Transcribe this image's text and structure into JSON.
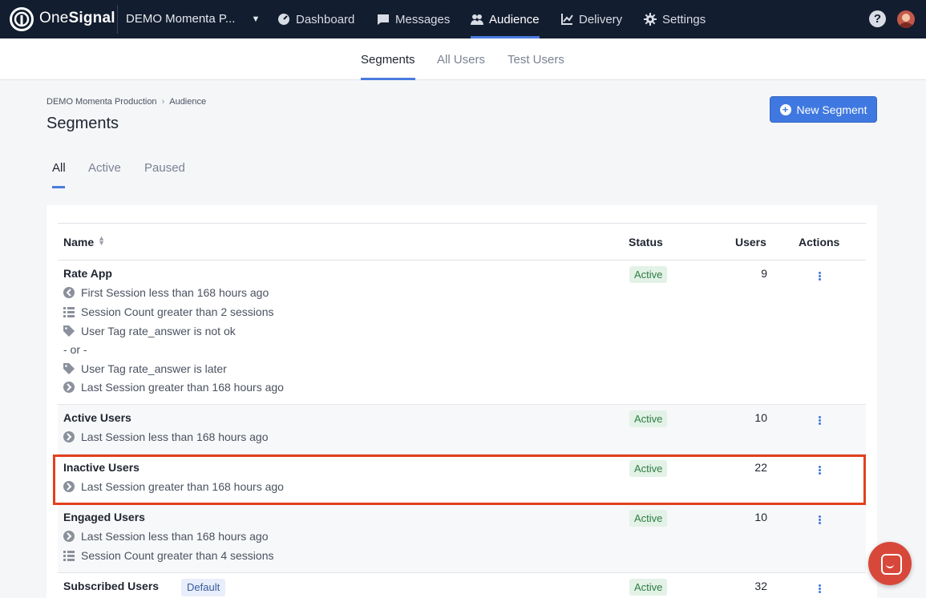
{
  "brand": {
    "name_light": "One",
    "name_bold": "Signal"
  },
  "app_selector": {
    "value": "DEMO Momenta P..."
  },
  "nav": {
    "items": [
      {
        "label": "Dashboard",
        "icon": "dashboard-icon"
      },
      {
        "label": "Messages",
        "icon": "messages-icon"
      },
      {
        "label": "Audience",
        "icon": "audience-icon",
        "active": true
      },
      {
        "label": "Delivery",
        "icon": "delivery-icon"
      },
      {
        "label": "Settings",
        "icon": "gear-icon"
      }
    ],
    "help": "?"
  },
  "subnav": {
    "tabs": [
      "Segments",
      "All Users",
      "Test Users"
    ],
    "active": "Segments"
  },
  "breadcrumb": {
    "root": "DEMO Momenta Production",
    "current": "Audience"
  },
  "page": {
    "title": "Segments",
    "new_button": "New Segment"
  },
  "filters": {
    "tabs": [
      "All",
      "Active",
      "Paused"
    ],
    "active": "All"
  },
  "table": {
    "headers": {
      "name": "Name",
      "status": "Status",
      "users": "Users",
      "actions": "Actions"
    },
    "rows": [
      {
        "name": "Rate App",
        "status": "Active",
        "users": "9",
        "rules": [
          {
            "icon": "first-session-icon",
            "text": "First Session less than 168 hours ago"
          },
          {
            "icon": "list-icon",
            "text": "Session Count greater than 2 sessions"
          },
          {
            "icon": "tag-icon",
            "text": "User Tag rate_answer is not ok"
          },
          {
            "icon": "",
            "text": "- or -"
          },
          {
            "icon": "tag-icon",
            "text": "User Tag rate_answer is later"
          },
          {
            "icon": "last-session-icon",
            "text": "Last Session greater than 168 hours ago"
          }
        ]
      },
      {
        "name": "Active Users",
        "status": "Active",
        "users": "10",
        "rules": [
          {
            "icon": "last-session-icon",
            "text": "Last Session less than 168 hours ago"
          }
        ]
      },
      {
        "name": "Inactive Users",
        "status": "Active",
        "users": "22",
        "rules": [
          {
            "icon": "last-session-icon",
            "text": "Last Session greater than 168 hours ago"
          }
        ]
      },
      {
        "name": "Engaged Users",
        "status": "Active",
        "users": "10",
        "rules": [
          {
            "icon": "last-session-icon",
            "text": "Last Session less than 168 hours ago"
          },
          {
            "icon": "list-icon",
            "text": "Session Count greater than 4 sessions"
          }
        ]
      },
      {
        "name": "Subscribed Users",
        "default_badge": "Default",
        "status": "Active",
        "users": "32",
        "rules": []
      }
    ]
  },
  "colors": {
    "nav_bg": "#121d2f",
    "accent": "#3f78e0",
    "status_active_bg": "#e3f2e6",
    "status_active_fg": "#2e7d45",
    "highlight": "#e2401f"
  }
}
